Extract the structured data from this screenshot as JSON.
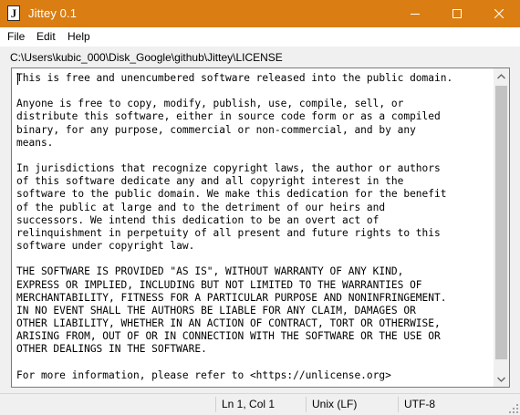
{
  "window": {
    "title": "Jittey 0.1",
    "app_icon_glyph": "J",
    "accent_color": "#da7e13"
  },
  "menu": {
    "items": [
      "File",
      "Edit",
      "Help"
    ]
  },
  "path": {
    "text": "C:\\Users\\kubic_000\\Disk_Google\\github\\Jittey\\LICENSE"
  },
  "editor": {
    "content": "This is free and unencumbered software released into the public domain.\n\nAnyone is free to copy, modify, publish, use, compile, sell, or\ndistribute this software, either in source code form or as a compiled\nbinary, for any purpose, commercial or non-commercial, and by any\nmeans.\n\nIn jurisdictions that recognize copyright laws, the author or authors\nof this software dedicate any and all copyright interest in the\nsoftware to the public domain. We make this dedication for the benefit\nof the public at large and to the detriment of our heirs and\nsuccessors. We intend this dedication to be an overt act of\nrelinquishment in perpetuity of all present and future rights to this\nsoftware under copyright law.\n\nTHE SOFTWARE IS PROVIDED \"AS IS\", WITHOUT WARRANTY OF ANY KIND,\nEXPRESS OR IMPLIED, INCLUDING BUT NOT LIMITED TO THE WARRANTIES OF\nMERCHANTABILITY, FITNESS FOR A PARTICULAR PURPOSE AND NONINFRINGEMENT.\nIN NO EVENT SHALL THE AUTHORS BE LIABLE FOR ANY CLAIM, DAMAGES OR\nOTHER LIABILITY, WHETHER IN AN ACTION OF CONTRACT, TORT OR OTHERWISE,\nARISING FROM, OUT OF OR IN CONNECTION WITH THE SOFTWARE OR THE USE OR\nOTHER DEALINGS IN THE SOFTWARE.\n\nFor more information, please refer to <https://unlicense.org>"
  },
  "status": {
    "position": "Ln 1, Col 1",
    "line_endings": "Unix (LF)",
    "encoding": "UTF-8"
  },
  "icons": {
    "minimize": "minimize-icon",
    "maximize": "maximize-icon",
    "close": "close-icon",
    "scroll_up": "chevron-up-icon",
    "scroll_down": "chevron-down-icon",
    "resize_grip": "resize-grip-icon"
  }
}
